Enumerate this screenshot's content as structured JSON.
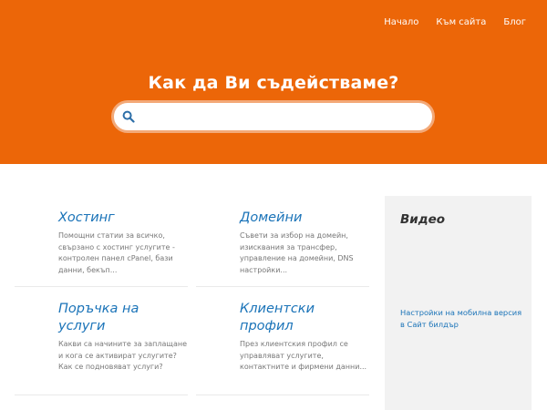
{
  "nav": {
    "items": [
      "Начало",
      "Към сайта",
      "Блог"
    ]
  },
  "hero": {
    "title": "Как да Ви съдействаме?",
    "search_placeholder": "",
    "search_value": ""
  },
  "cards": [
    {
      "title": "Хостинг",
      "description": "Помощни статии за всичко, свързано с хостинг услугите - контролен панел cPanel, бази данни, бекъп..."
    },
    {
      "title": "Домейни",
      "description": "Съвети за избор на домейн, изисквания за трансфер, управление на домейни, DNS настройки..."
    },
    {
      "title": "Поръчка на услуги",
      "description": "Какви са начините за заплащане и кога се активират услугите? Как се подновяват услуги?"
    },
    {
      "title": "Клиентски профил",
      "description": "През клиентския профил се управляват услугите, контактните и фирмени данни..."
    }
  ],
  "sidebar": {
    "title": "Видео",
    "link": "Настройки на мобилна версия в Сайт билдър"
  },
  "colors": {
    "brand_orange": "#ec6608",
    "link_blue": "#1a73b8",
    "sidebar_bg": "#f2f2f2",
    "search_icon": "#2d6fa8"
  },
  "icons": {
    "search": "search-icon"
  }
}
